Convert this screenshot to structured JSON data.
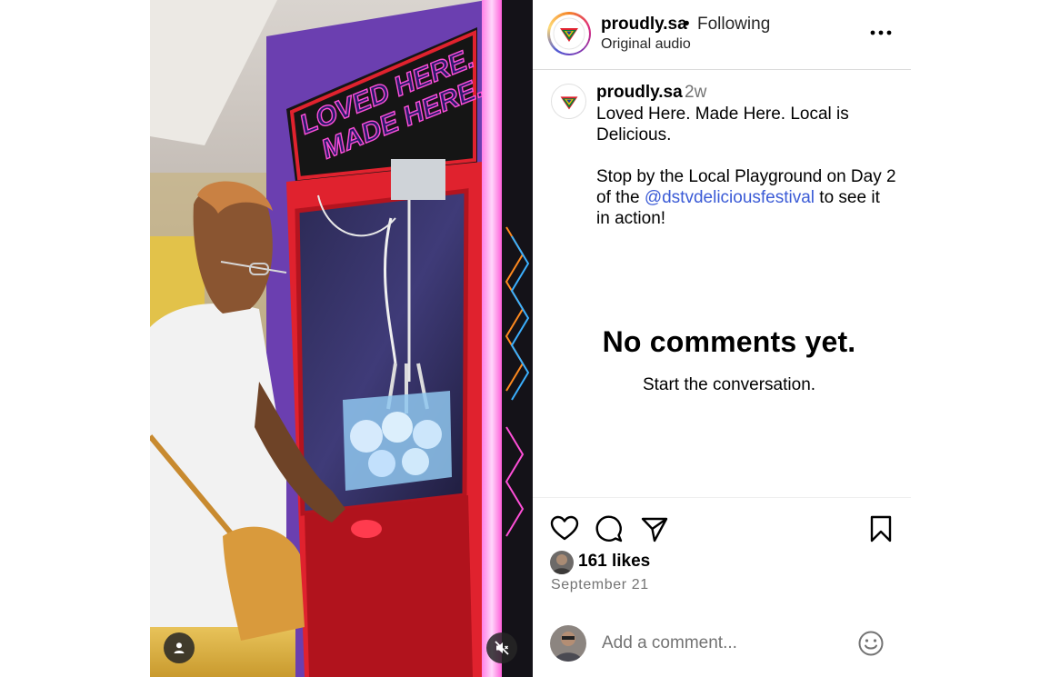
{
  "media": {
    "sign_line1": "LOVED HERE.",
    "sign_line2": "MADE HERE.",
    "user_button_icon": "user-icon",
    "mute_button_icon": "sound-off-icon"
  },
  "header": {
    "username": "proudly.sa",
    "separator": "•",
    "follow_status": "Following",
    "audio_label": "Original audio",
    "more_icon": "more-options-icon"
  },
  "caption": {
    "username": "proudly.sa",
    "time_ago": "2w",
    "paragraph1": "Loved Here. Made Here. Local is Delicious.",
    "paragraph2_before": "Stop by the Local Playground on Day 2 of the ",
    "mention": "@dstvdeliciousfestival",
    "paragraph2_after": " to see it in action!"
  },
  "comments": {
    "empty_title": "No comments yet.",
    "empty_subtitle": "Start the conversation."
  },
  "actions": {
    "icons": [
      "heart-icon",
      "comment-icon",
      "share-icon",
      "bookmark-icon"
    ],
    "likes": "161 likes",
    "date": "September 21"
  },
  "add_comment": {
    "placeholder": "Add a comment...",
    "emoji_icon": "smiley-icon"
  },
  "colors": {
    "mention": "#3b5bd6",
    "muted_text": "#737373",
    "divider": "#dbdbdb",
    "neon_pink": "#ff4fd8",
    "cabinet_red": "#e0222e"
  }
}
